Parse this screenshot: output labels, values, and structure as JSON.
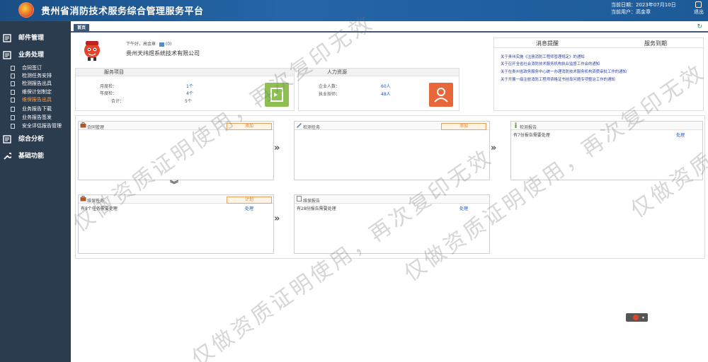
{
  "header": {
    "title": "贵州省消防技术服务综合管理服务平台",
    "date_label": "当前日期：2023年07月10日",
    "user_label": "当前用户：高金章",
    "logout": "退出"
  },
  "sidebar": {
    "groups": [
      {
        "label": "邮件管理",
        "icon": "mail-icon"
      },
      {
        "label": "业务处理",
        "icon": "document-icon"
      },
      {
        "label": "综合分析",
        "icon": "chart-icon"
      },
      {
        "label": "基础功能",
        "icon": "wrench-icon"
      }
    ],
    "items": [
      {
        "label": "合同签订"
      },
      {
        "label": "检测任务安排"
      },
      {
        "label": "检测报告出具"
      },
      {
        "label": "维保计划制定"
      },
      {
        "label": "维保报告出具",
        "active": true
      },
      {
        "label": "业务报告下载"
      },
      {
        "label": "业务报告签发"
      },
      {
        "label": "安全评估报告管理"
      }
    ]
  },
  "tabs": [
    {
      "label": "首页"
    }
  ],
  "profile": {
    "greeting": "下午好，高金章",
    "msg_count": "(0)",
    "company": "贵州天纬煜系统技术有限公司"
  },
  "service": {
    "title": "服务项目",
    "rows": [
      {
        "label": "月度检：",
        "value": "1个"
      },
      {
        "label": "年度检：",
        "value": "4个"
      },
      {
        "label": "合计：",
        "value": "5个"
      }
    ]
  },
  "hr": {
    "title": "人力资源",
    "rows": [
      {
        "label": "企业人数：",
        "value": "60人"
      },
      {
        "label": "执业技师：",
        "value": "48人"
      }
    ]
  },
  "notices": {
    "tab_reminder": "消息提醒",
    "tab_expiry": "服务到期",
    "items": [
      "关于贵州实施《注册消防工程师管理规定》的通知",
      "关于召开全省社会消防技术服务机构执业监督工作会的通知",
      "关于在贵州省政务服务中心统一办理消防技术服务机构资质审批工作的通知",
      "关于开展一级注册消防工程师资格证书挂靠问题专项整治工作的通知"
    ]
  },
  "panels": {
    "contract": {
      "title": "合同管理",
      "button": "添加"
    },
    "inspection": {
      "title": "检测任务",
      "button": "添加"
    },
    "inspection_report": {
      "title": "检测报告",
      "line": "有7份报告需要处理",
      "link": "处理"
    },
    "maintenance": {
      "title": "维保任务",
      "button": "计划",
      "line": "有8个任务需要处理",
      "link": "处理"
    },
    "maintenance_report": {
      "title": "维保报告",
      "line": "有28份报告需要处理",
      "link": "处理"
    }
  },
  "arrows": {
    "right": "»",
    "down": "︾"
  },
  "watermark": "仅做资质证明使用，再次复印无效",
  "colors": {
    "header": "#2566a8",
    "sidebar": "#2b3c4f",
    "active": "#f0a24b",
    "link": "#2255aa",
    "button_border": "#e6a25a"
  }
}
